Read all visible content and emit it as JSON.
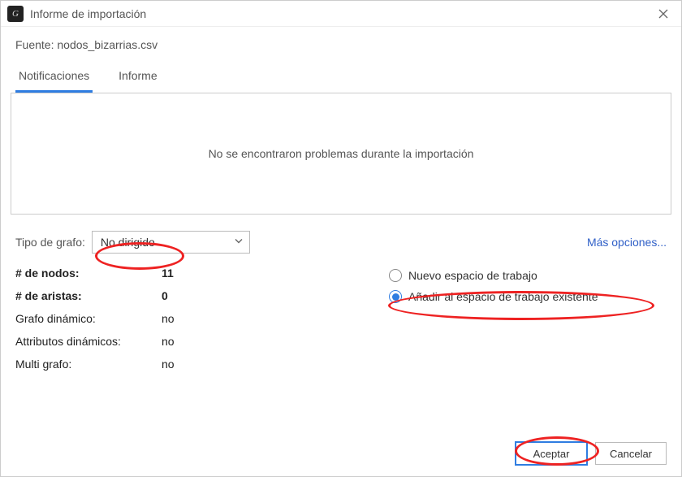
{
  "titlebar": {
    "title": "Informe de importación"
  },
  "source": {
    "label": "Fuente:",
    "value": "nodos_bizarrias.csv"
  },
  "tabs": {
    "notifications": "Notificaciones",
    "report": "Informe"
  },
  "notification_message": "No se encontraron problemas durante la importación",
  "graph_type": {
    "label": "Tipo de grafo:",
    "value": "No dirigido"
  },
  "more_options": "Más opciones...",
  "stats": {
    "nodes_label": "# de nodos:",
    "nodes_value": "11",
    "edges_label": "# de aristas:",
    "edges_value": "0",
    "dynamic_graph_label": "Grafo dinámico:",
    "dynamic_graph_value": "no",
    "dynamic_attrs_label": "Attributos dinámicos:",
    "dynamic_attrs_value": "no",
    "multi_graph_label": "Multi grafo:",
    "multi_graph_value": "no"
  },
  "workspace": {
    "new_label": "Nuevo espacio de trabajo",
    "existing_label": "Añadir al espacio de trabajo existente"
  },
  "buttons": {
    "accept": "Aceptar",
    "cancel": "Cancelar"
  }
}
